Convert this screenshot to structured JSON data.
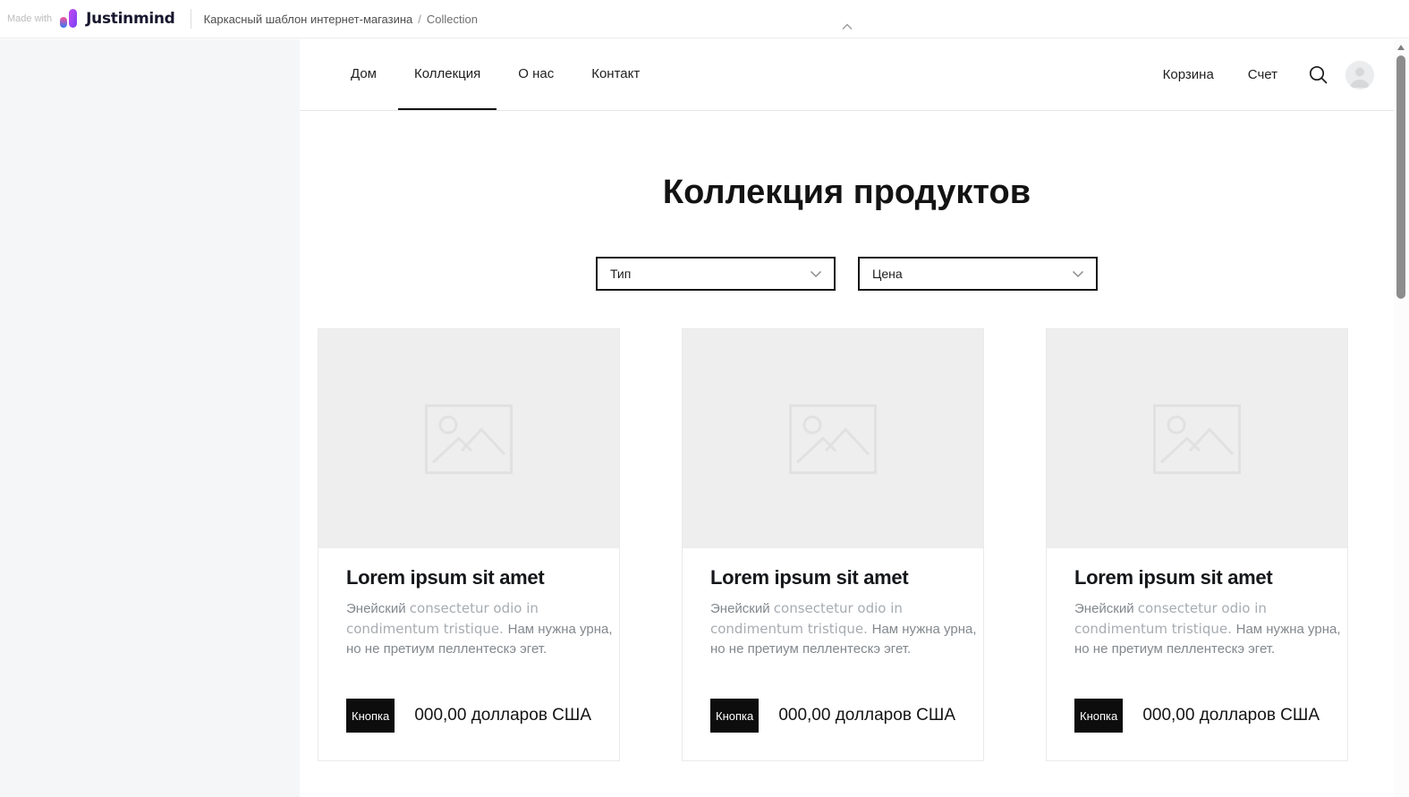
{
  "colors": {
    "accent": "#111111",
    "gutter_bg": "#f5f6f7",
    "image_placeholder_bg": "#eeeeee",
    "muted_text": "#9aa0a6",
    "scrollbar_thumb": "#8d8d8d",
    "brand_gradient_top": "#c44af1",
    "brand_gradient_bottom": "#7a41f5"
  },
  "icons": {
    "search": "magnifier",
    "account": "person-circle",
    "collapse": "chevron-up",
    "dropdown": "chevron-down",
    "image_placeholder": "picture-frame",
    "scroll_up": "triangle-up"
  },
  "toolbar": {
    "made_with": "Made with",
    "brand": "Justinmind",
    "breadcrumb": {
      "project": "Каркасный шаблон интернет-магазина",
      "separator": "/",
      "page": "Collection"
    }
  },
  "nav": {
    "items": [
      {
        "label": "Дом",
        "active": false
      },
      {
        "label": "Коллекция",
        "active": true
      },
      {
        "label": "О нас",
        "active": false
      },
      {
        "label": "Контакт",
        "active": false
      }
    ],
    "cart_label": "Корзина",
    "account_label": "Счет"
  },
  "page": {
    "title": "Коллекция продуктов",
    "filters": [
      {
        "label": "Тип"
      },
      {
        "label": "Цена"
      }
    ]
  },
  "products": [
    {
      "title": "Lorem ipsum sit amet",
      "description_cyr1": "Энейский ",
      "description_lat": "consectetur odio in condimentum tristique. ",
      "description_cyr2": "Нам нужна урна, но не претиум пеллентескэ эгет.",
      "button_label": "Кнопка",
      "price": "000,00 долларов США"
    },
    {
      "title": "Lorem ipsum sit amet",
      "description_cyr1": "Энейский ",
      "description_lat": "consectetur odio in condimentum tristique. ",
      "description_cyr2": "Нам нужна урна, но не претиум пеллентескэ эгет.",
      "button_label": "Кнопка",
      "price": "000,00 долларов США"
    },
    {
      "title": "Lorem ipsum sit amet",
      "description_cyr1": "Энейский ",
      "description_lat": "consectetur odio in condimentum tristique. ",
      "description_cyr2": "Нам нужна урна, но не претиум пеллентескэ эгет.",
      "button_label": "Кнопка",
      "price": "000,00 долларов США"
    }
  ]
}
